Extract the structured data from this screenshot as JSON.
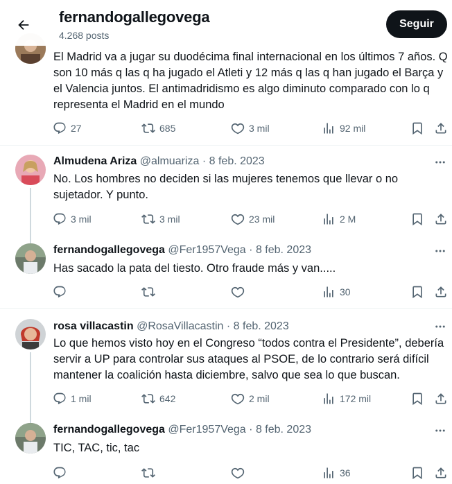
{
  "header": {
    "profile_name": "fernandogallegovega",
    "post_count": "4.268 posts",
    "follow_label": "Seguir"
  },
  "tweets": [
    {
      "text": "El Madrid va a jugar su duodécima final internacional en los últimos 7 años. Q son 10 más q las q ha jugado el Atleti y 12 más q las q han jugado el Barça y el Valencia juntos. El antimadridismo es algo diminuto comparado con lo q representa el Madrid en el mundo",
      "replies": "27",
      "retweets": "685",
      "likes": "3 mil",
      "views": "92 mil"
    },
    {
      "name": "Almudena Ariza",
      "handle": "@almuariza",
      "dot": "·",
      "date": "8 feb. 2023",
      "text": "No. Los hombres no deciden si las mujeres tenemos que llevar o no sujetador. Y punto.",
      "replies": "3 mil",
      "retweets": "3 mil",
      "likes": "23 mil",
      "views": "2 M"
    },
    {
      "name": "fernandogallegovega",
      "handle": "@Fer1957Vega",
      "dot": "·",
      "date": "8 feb. 2023",
      "text": "Has sacado la pata del tiesto. Otro fraude más y van.....",
      "replies": "",
      "retweets": "",
      "likes": "",
      "views": "30"
    },
    {
      "name": "rosa villacastin",
      "handle": "@RosaVillacastin",
      "dot": "·",
      "date": "8 feb. 2023",
      "text": "Lo que hemos visto hoy en el Congreso “todos contra el Presidente”, debería servir a UP para controlar sus ataques al PSOE, de lo contrario será difícil mantener la coalición hasta diciembre, salvo que sea lo que buscan.",
      "replies": "1 mil",
      "retweets": "642",
      "likes": "2 mil",
      "views": "172 mil"
    },
    {
      "name": "fernandogallegovega",
      "handle": "@Fer1957Vega",
      "dot": "·",
      "date": "8 feb. 2023",
      "text": "TIC, TAC, tic, tac",
      "replies": "",
      "retweets": "",
      "likes": "",
      "views": "36"
    }
  ],
  "colors": {
    "text": "#0f1419",
    "muted": "#536471",
    "divider": "#eff3f4",
    "thread_line": "#cfd9de"
  },
  "icons": [
    "back-arrow-icon",
    "more-icon",
    "reply-icon",
    "retweet-icon",
    "like-icon",
    "views-icon",
    "bookmark-icon",
    "share-icon"
  ]
}
